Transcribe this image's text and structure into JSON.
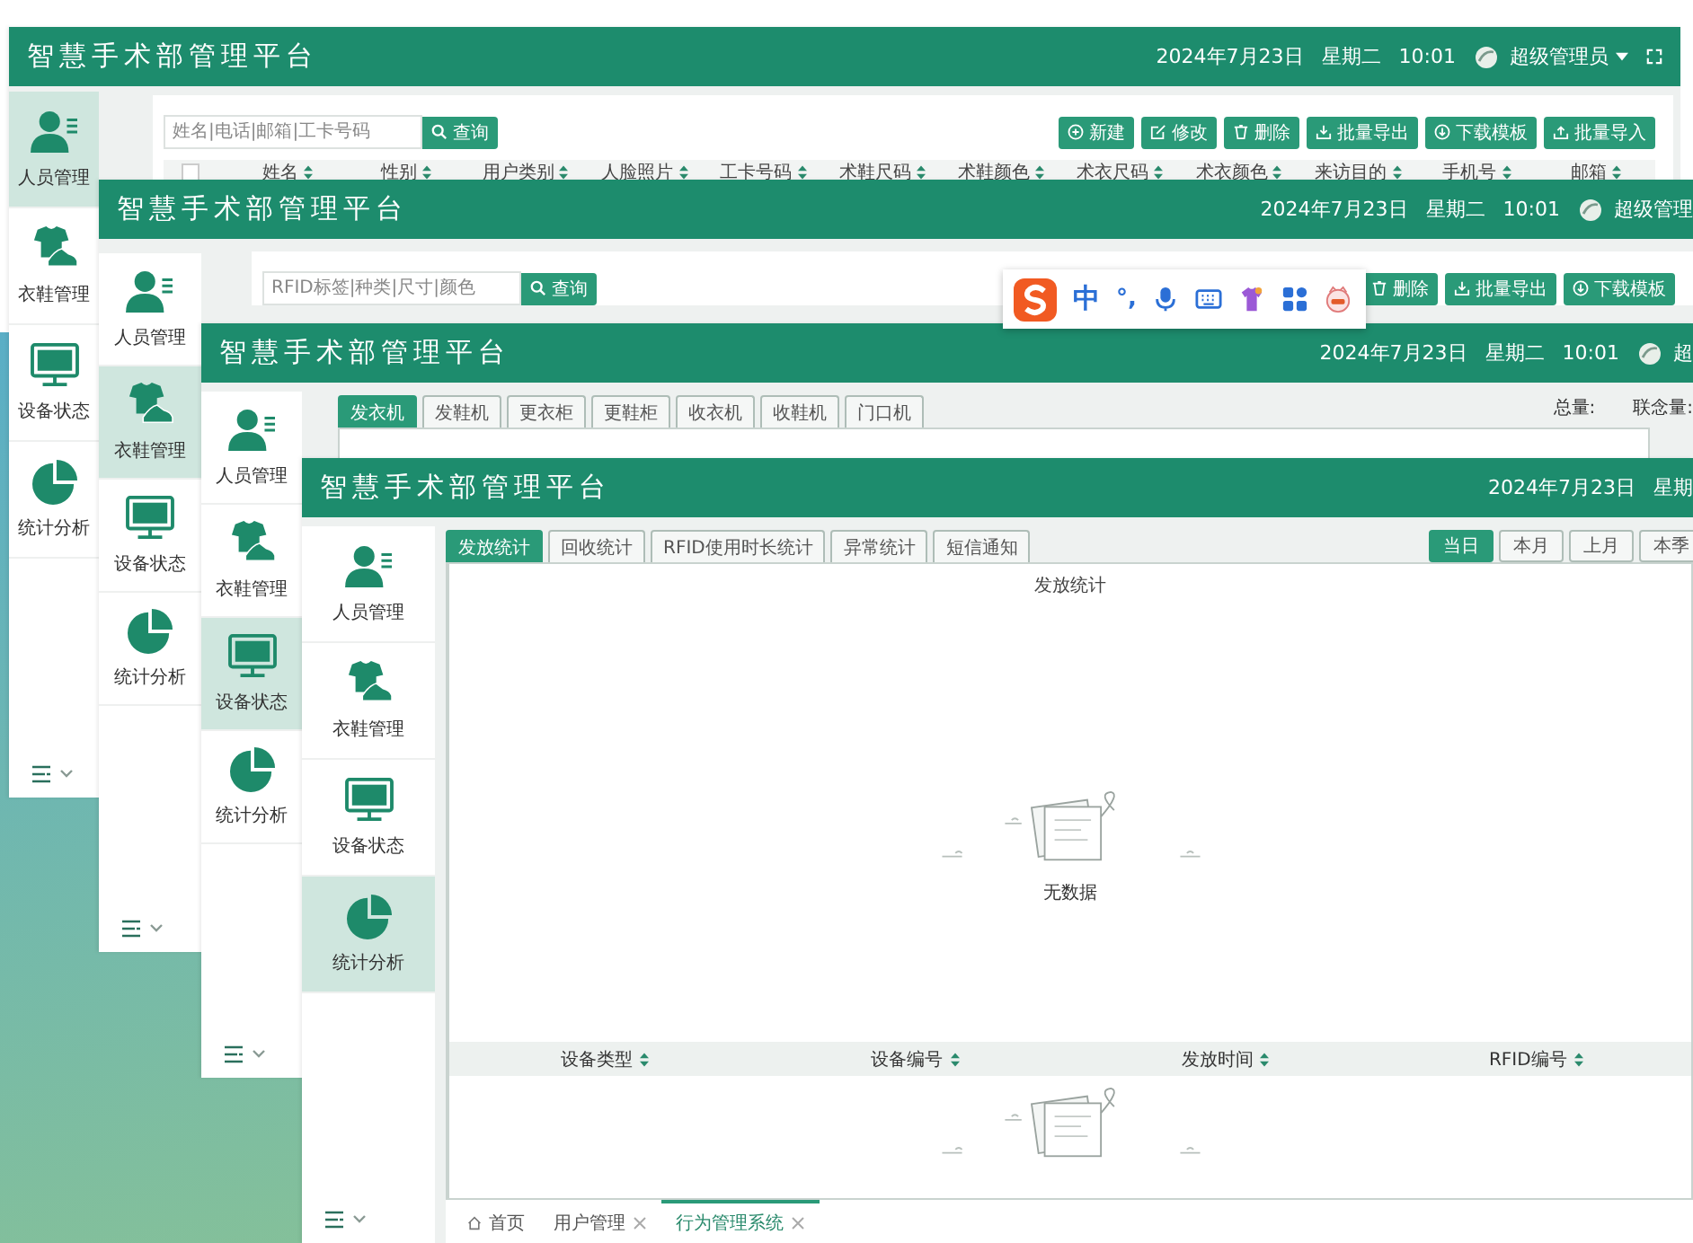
{
  "windows": [
    {
      "title": "智慧手术部管理平台",
      "date": "2024年7月23日",
      "weekday": "星期二",
      "time": "10:01",
      "user": "超级管理员",
      "nav": [
        {
          "label": "人员管理",
          "selected": true
        },
        {
          "label": "衣鞋管理",
          "selected": false
        },
        {
          "label": "设备状态",
          "selected": false
        },
        {
          "label": "统计分析",
          "selected": false
        }
      ],
      "content": {
        "kind": "table",
        "search": {
          "placeholder": "姓名|电话|邮箱|工卡号码"
        },
        "search_button": "查询",
        "actions": [
          {
            "label": "新建",
            "kind": "add"
          },
          {
            "label": "修改",
            "kind": "edit"
          },
          {
            "label": "删除",
            "kind": "delete"
          },
          {
            "label": "批量导出",
            "kind": "export"
          },
          {
            "label": "下载模板",
            "kind": "download"
          },
          {
            "label": "批量导入",
            "kind": "import"
          }
        ],
        "select_all": false,
        "columns": [
          "姓名",
          "性别",
          "用户类别",
          "人脸照片",
          "工卡号码",
          "术鞋尺码",
          "术鞋颜色",
          "术衣尺码",
          "术衣颜色",
          "来访目的",
          "手机号",
          "邮箱"
        ]
      }
    },
    {
      "title": "智慧手术部管理平台",
      "date": "2024年7月23日",
      "weekday": "星期二",
      "time": "10:01",
      "user": "超级管理",
      "nav": [
        {
          "label": "人员管理",
          "selected": false
        },
        {
          "label": "衣鞋管理",
          "selected": true
        },
        {
          "label": "设备状态",
          "selected": false
        },
        {
          "label": "统计分析",
          "selected": false
        }
      ],
      "content": {
        "kind": "table",
        "search": {
          "placeholder": "RFID标签|种类|尺寸|颜色"
        },
        "search_button": "查询",
        "actions": [
          {
            "label": "删除",
            "kind": "delete"
          },
          {
            "label": "批量导出",
            "kind": "export"
          },
          {
            "label": "下载模板",
            "kind": "download"
          }
        ]
      }
    },
    {
      "title": "智慧手术部管理平台",
      "date": "2024年7月23日",
      "weekday": "星期二",
      "time": "10:01",
      "user": "超",
      "nav": [
        {
          "label": "人员管理",
          "selected": false
        },
        {
          "label": "衣鞋管理",
          "selected": false
        },
        {
          "label": "设备状态",
          "selected": true
        },
        {
          "label": "统计分析",
          "selected": false
        }
      ],
      "content": {
        "kind": "device_tabs",
        "tabs": [
          {
            "label": "发衣机",
            "selected": true
          },
          {
            "label": "发鞋机",
            "selected": false
          },
          {
            "label": "更衣柜",
            "selected": false
          },
          {
            "label": "更鞋柜",
            "selected": false
          },
          {
            "label": "收衣机",
            "selected": false
          },
          {
            "label": "收鞋机",
            "selected": false
          },
          {
            "label": "门口机",
            "selected": false
          }
        ],
        "totals": [
          "总量:",
          "联念量:"
        ]
      }
    },
    {
      "title": "智慧手术部管理平台",
      "date": "2024年7月23日",
      "weekday": "星期",
      "nav": [
        {
          "label": "人员管理",
          "selected": false
        },
        {
          "label": "衣鞋管理",
          "selected": false
        },
        {
          "label": "设备状态",
          "selected": false
        },
        {
          "label": "统计分析",
          "selected": true
        }
      ],
      "content": {
        "kind": "stats",
        "tabs": [
          {
            "label": "发放统计",
            "selected": true
          },
          {
            "label": "回收统计",
            "selected": false
          },
          {
            "label": "RFID使用时长统计",
            "selected": false
          },
          {
            "label": "异常统计",
            "selected": false
          },
          {
            "label": "短信通知",
            "selected": false
          }
        ],
        "periods": [
          {
            "label": "当日",
            "selected": true
          },
          {
            "label": "本月",
            "selected": false
          },
          {
            "label": "上月",
            "selected": false
          },
          {
            "label": "本季",
            "selected": false
          }
        ],
        "chart_title": "发放统计",
        "empty_text": "无数据",
        "columns": [
          "设备类型",
          "设备编号",
          "发放时间",
          "RFID编号"
        ],
        "open_tabs": [
          {
            "label": "首页",
            "kind": "home",
            "selected": false
          },
          {
            "label": "用户管理",
            "kind": "closable",
            "selected": false
          },
          {
            "label": "行为管理系统",
            "kind": "closable",
            "selected": true
          }
        ]
      }
    }
  ],
  "ime": {
    "mode": "中",
    "punctuation": "°,"
  }
}
